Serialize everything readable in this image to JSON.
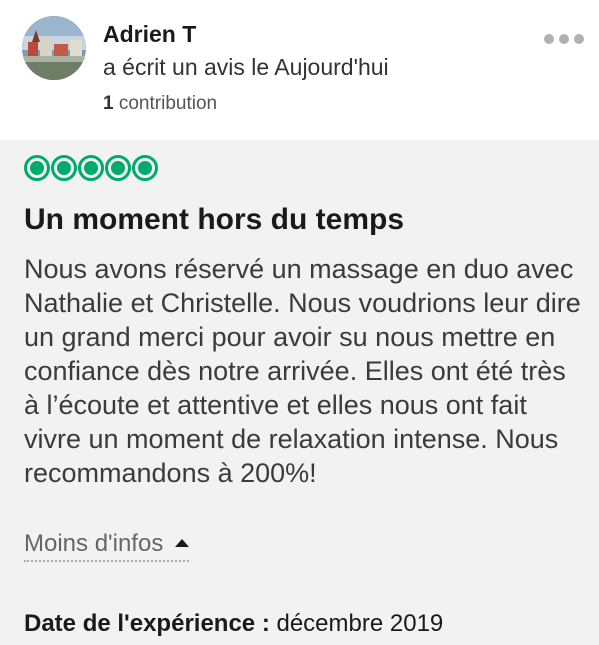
{
  "reviewer": {
    "name": "Adrien T",
    "action": "a écrit un avis le Aujourd'hui",
    "contributions_count": "1",
    "contributions_label": "contribution"
  },
  "review": {
    "rating": 5,
    "rating_max": 5,
    "rating_color": "#00aa6c",
    "title": "Un moment hors du temps",
    "body": "Nous avons réservé un massage en duo avec Nathalie et Christelle. Nous voudrions leur dire un grand merci pour avoir su nous mettre en confiance dès notre arrivée. Elles ont été très à l’écoute et attentive et elles nous ont fait vivre un moment de relaxation intense. Nous recommandons à 200%!",
    "toggle_label": "Moins d'infos",
    "date_label": "Date de l'expérience :",
    "date_value": "décembre 2019"
  },
  "icons": {
    "more": "more-dots-icon",
    "caret": "caret-up-icon"
  }
}
